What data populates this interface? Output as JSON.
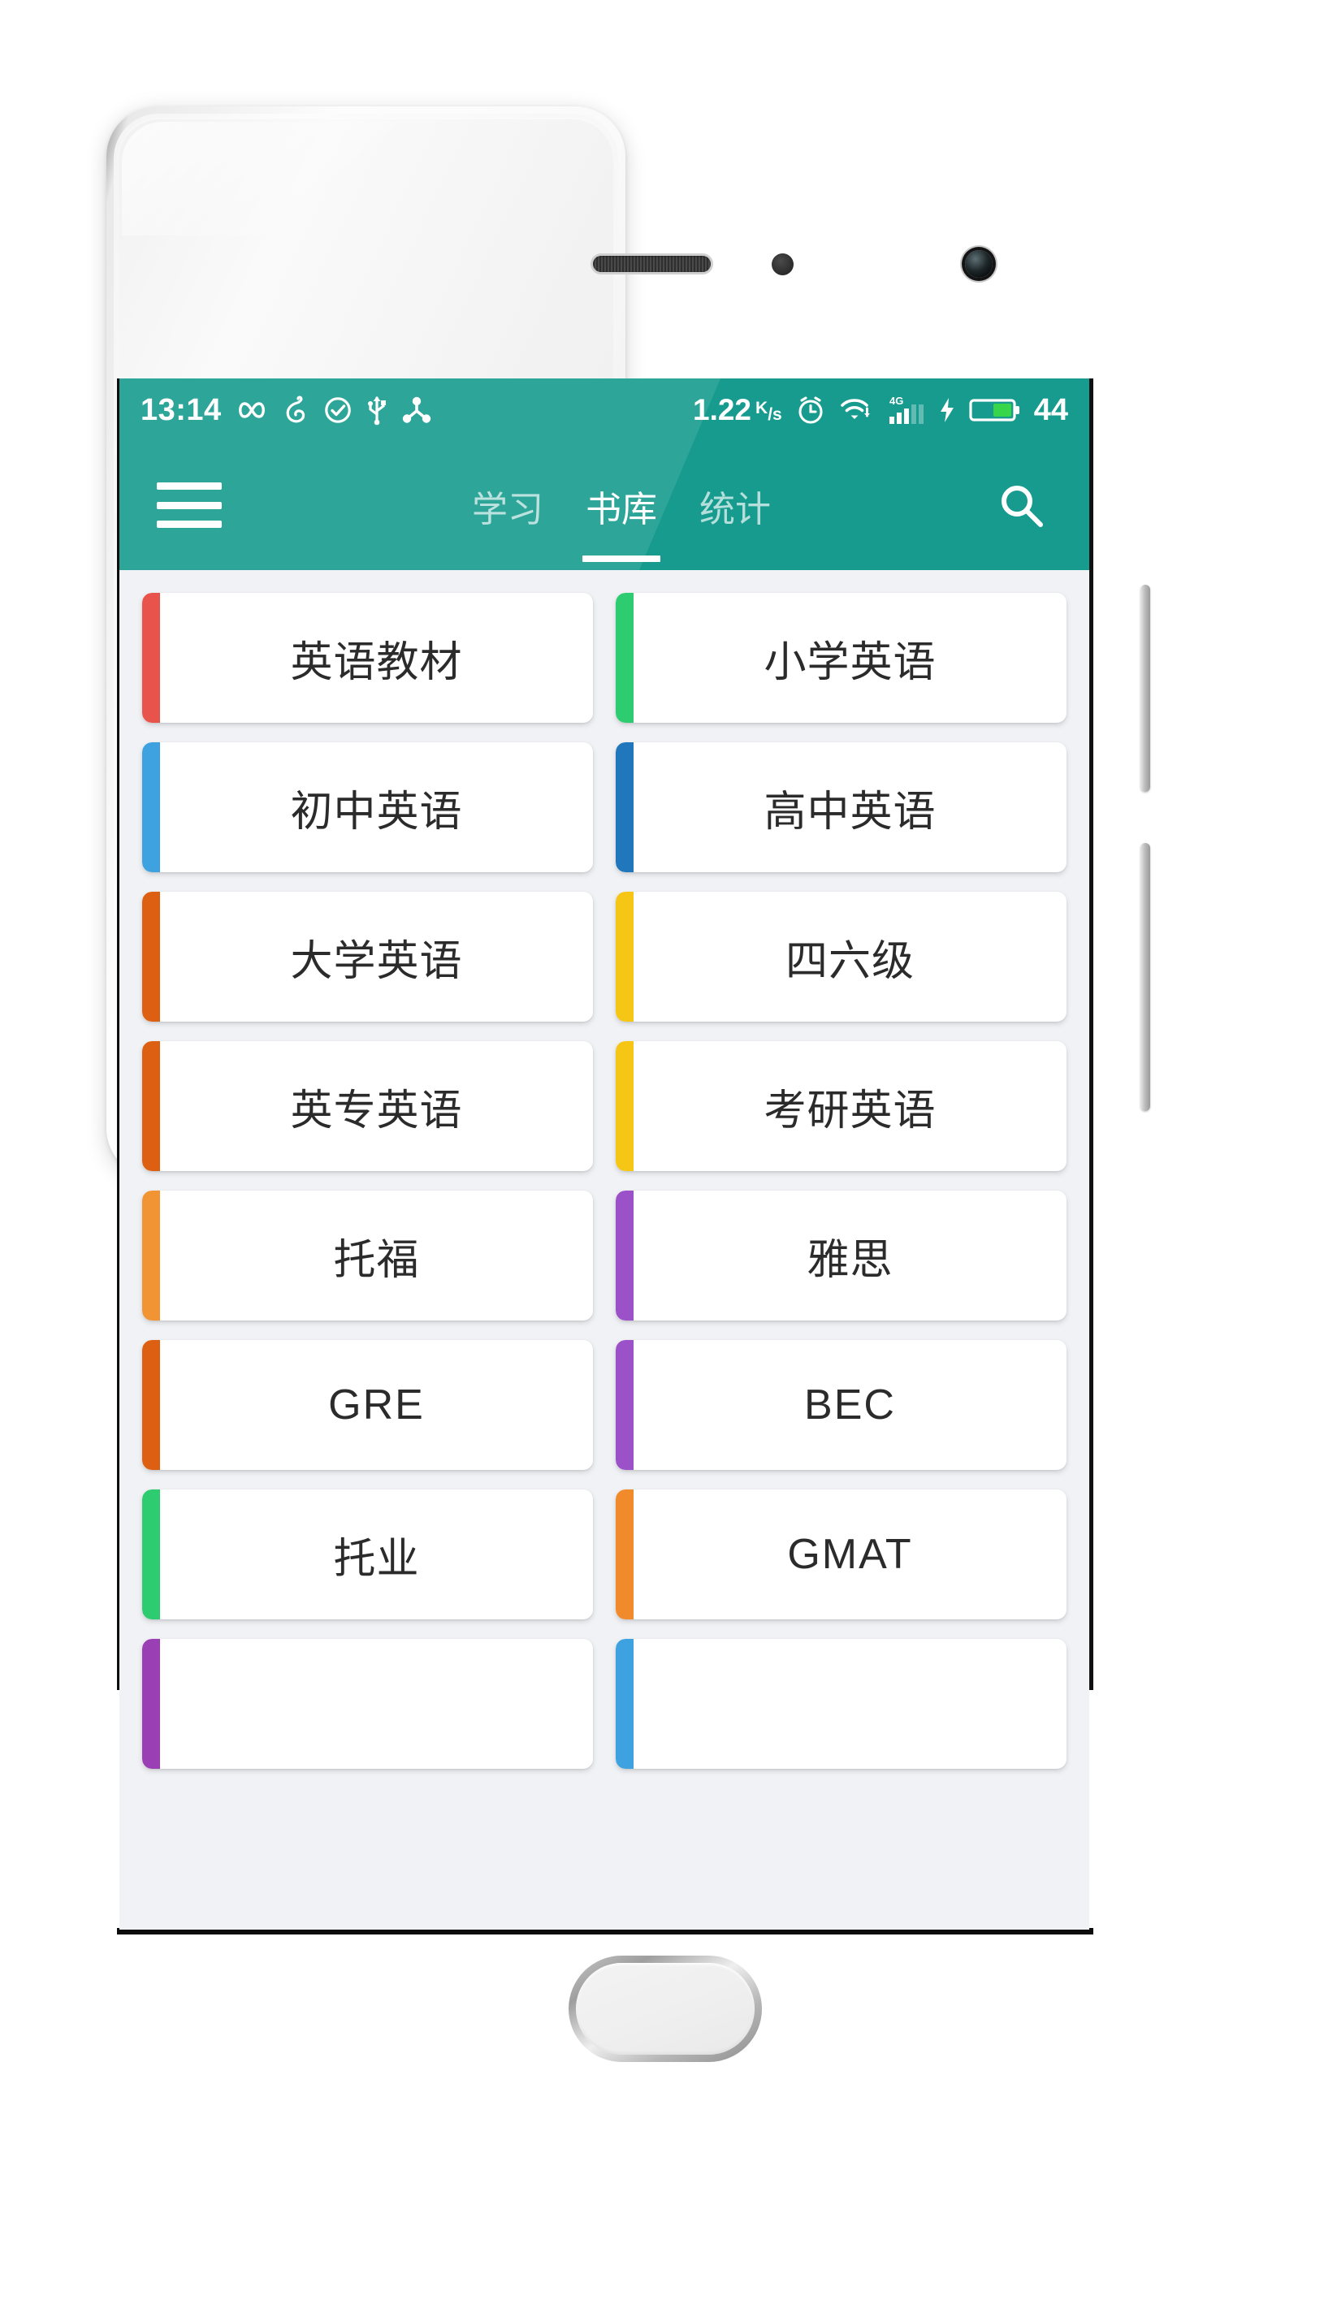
{
  "device": {
    "hardware": {
      "speaker": "earpiece-speaker",
      "sensor": "proximity-sensor",
      "front_camera": "front-camera",
      "home_button": "home-button",
      "volume_button": "volume-rocker",
      "power_button": "power-button"
    }
  },
  "status_bar": {
    "time": "13:14",
    "icons_left": [
      "infinity-icon",
      "netease-music-icon",
      "check-circle-icon",
      "usb-icon",
      "share-icon"
    ],
    "net_speed_value": "1.22",
    "net_speed_unit_k": "K",
    "net_speed_unit_s": "s",
    "net_speed_sep": "/",
    "icons_right": [
      "alarm-clock-icon",
      "wifi-download-icon",
      "signal-4g-icon",
      "charging-bolt-icon",
      "battery-icon"
    ],
    "signal_label": "4G",
    "battery_percent": "44",
    "bg_color": "#179B8E"
  },
  "app_bar": {
    "menu_icon": "hamburger-menu-icon",
    "search_icon": "search-icon",
    "bg_color": "#179B8E",
    "tabs": [
      {
        "label": "学习",
        "active": false
      },
      {
        "label": "书库",
        "active": true
      },
      {
        "label": "统计",
        "active": false
      }
    ]
  },
  "library": {
    "background": "#F0F2F5",
    "cards": [
      {
        "label": "英语教材",
        "accent": "#E8544B",
        "latin": false
      },
      {
        "label": "小学英语",
        "accent": "#2ECC71",
        "latin": false
      },
      {
        "label": "初中英语",
        "accent": "#3FA2E0",
        "latin": false
      },
      {
        "label": "高中英语",
        "accent": "#2077BB",
        "latin": false
      },
      {
        "label": "大学英语",
        "accent": "#DD5F11",
        "latin": false
      },
      {
        "label": "四六级",
        "accent": "#F5C613",
        "latin": false
      },
      {
        "label": "英专英语",
        "accent": "#DD5F11",
        "latin": false
      },
      {
        "label": "考研英语",
        "accent": "#F5C613",
        "latin": false
      },
      {
        "label": "托福",
        "accent": "#F09434",
        "latin": false
      },
      {
        "label": "雅思",
        "accent": "#9B51C7",
        "latin": false
      },
      {
        "label": "GRE",
        "accent": "#DD5F11",
        "latin": true
      },
      {
        "label": "BEC",
        "accent": "#9B51C7",
        "latin": true
      },
      {
        "label": "托业",
        "accent": "#2ECC71",
        "latin": false
      },
      {
        "label": "GMAT",
        "accent": "#F08A2A",
        "latin": true
      },
      {
        "label": "",
        "accent": "#9B3FB5",
        "latin": false
      },
      {
        "label": "",
        "accent": "#3FA2E0",
        "latin": false
      }
    ]
  }
}
